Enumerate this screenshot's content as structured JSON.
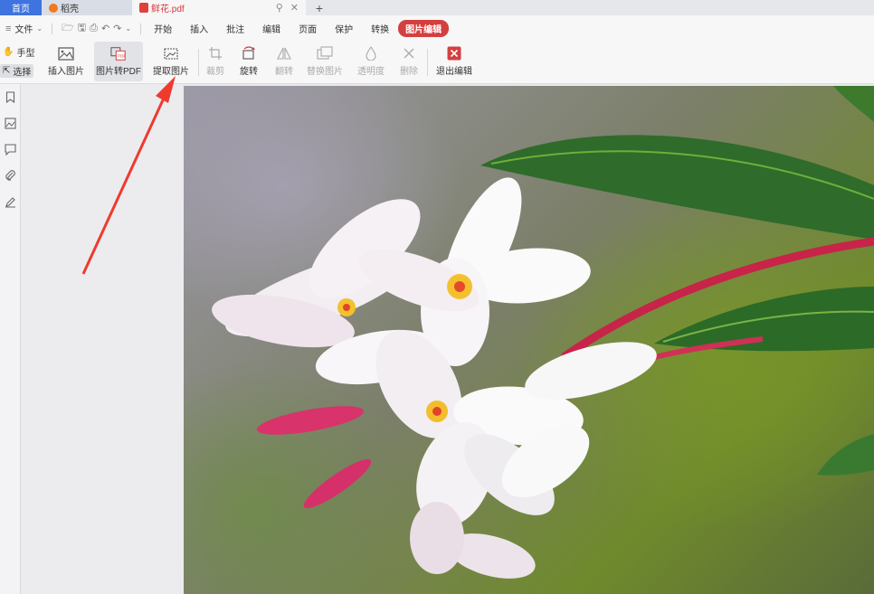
{
  "tabs": {
    "home": "首页",
    "daoke": "稻壳",
    "file": "鲜花.pdf",
    "new_tab": "+"
  },
  "menu": {
    "file": "文件",
    "items": [
      "开始",
      "插入",
      "批注",
      "编辑",
      "页面",
      "保护",
      "转换"
    ],
    "active": "图片编辑"
  },
  "toolbar": {
    "hand": "手型",
    "select": "选择",
    "insert_image": "插入图片",
    "image_to_pdf": "图片转PDF",
    "extract_image": "提取图片",
    "crop": "裁剪",
    "rotate": "旋转",
    "flip": "翻转",
    "replace_image": "替换图片",
    "opacity": "透明度",
    "delete": "删除",
    "exit_edit": "退出编辑"
  },
  "colors": {
    "accent": "#d4403e",
    "home_tab": "#3e73e0",
    "arrow": "#f03a2e"
  }
}
